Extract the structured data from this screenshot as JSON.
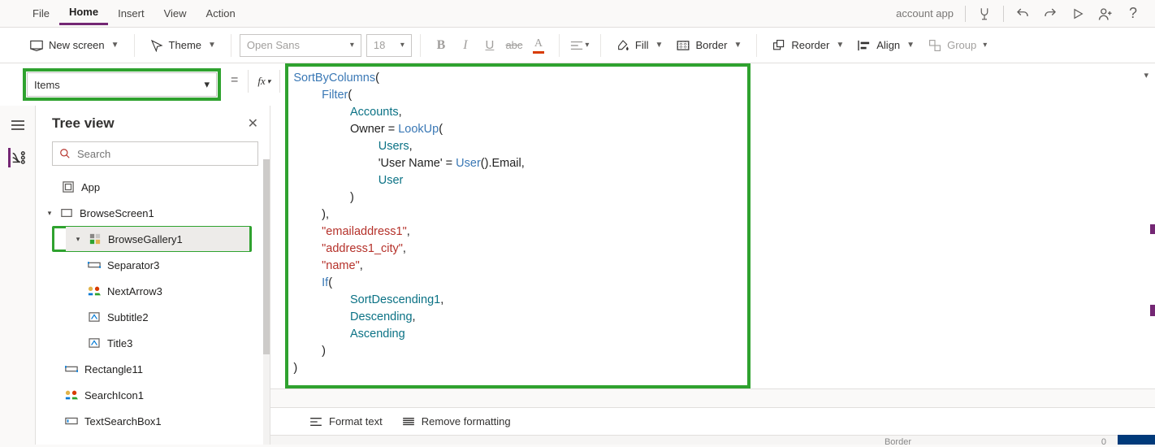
{
  "menu": {
    "file": "File",
    "home": "Home",
    "insert": "Insert",
    "view": "View",
    "action": "Action",
    "appName": "account app"
  },
  "ribbon": {
    "newScreen": "New screen",
    "theme": "Theme",
    "font": "Open Sans",
    "size": "18",
    "fill": "Fill",
    "border": "Border",
    "reorder": "Reorder",
    "align": "Align",
    "group": "Group"
  },
  "propertySelector": "Items",
  "fx": "fx",
  "tree": {
    "title": "Tree view",
    "searchPlaceholder": "Search",
    "app": "App",
    "browseScreen": "BrowseScreen1",
    "browseGallery": "BrowseGallery1",
    "separator": "Separator3",
    "nextArrow": "NextArrow3",
    "subtitle": "Subtitle2",
    "title3": "Title3",
    "rectangle": "Rectangle11",
    "searchIcon": "SearchIcon1",
    "textSearchBox": "TextSearchBox1"
  },
  "formula": {
    "l1a": "SortByColumns",
    "l1b": "(",
    "l2a": "Filter",
    "l2b": "(",
    "l3a": "Accounts",
    "l3b": ",",
    "l4a": "Owner = ",
    "l4b": "LookUp",
    "l4c": "(",
    "l5a": "Users",
    "l5b": ",",
    "l6a": "'User Name' = ",
    "l6b": "User",
    "l6c": "().Email,",
    "l7a": "User",
    "l8": ")",
    "l9": "),",
    "l10a": "\"emailaddress1\"",
    "l10b": ",",
    "l11a": "\"address1_city\"",
    "l11b": ",",
    "l12a": "\"name\"",
    "l12b": ",",
    "l13a": "If",
    "l13b": "(",
    "l14a": "SortDescending1",
    "l14b": ",",
    "l15a": "Descending",
    "l15b": ",",
    "l16a": "Ascending",
    "l17": ")",
    "l18": ")"
  },
  "formatBar": {
    "format": "Format text",
    "remove": "Remove formatting"
  },
  "bottom": {
    "border": "Border",
    "zero": "0"
  }
}
